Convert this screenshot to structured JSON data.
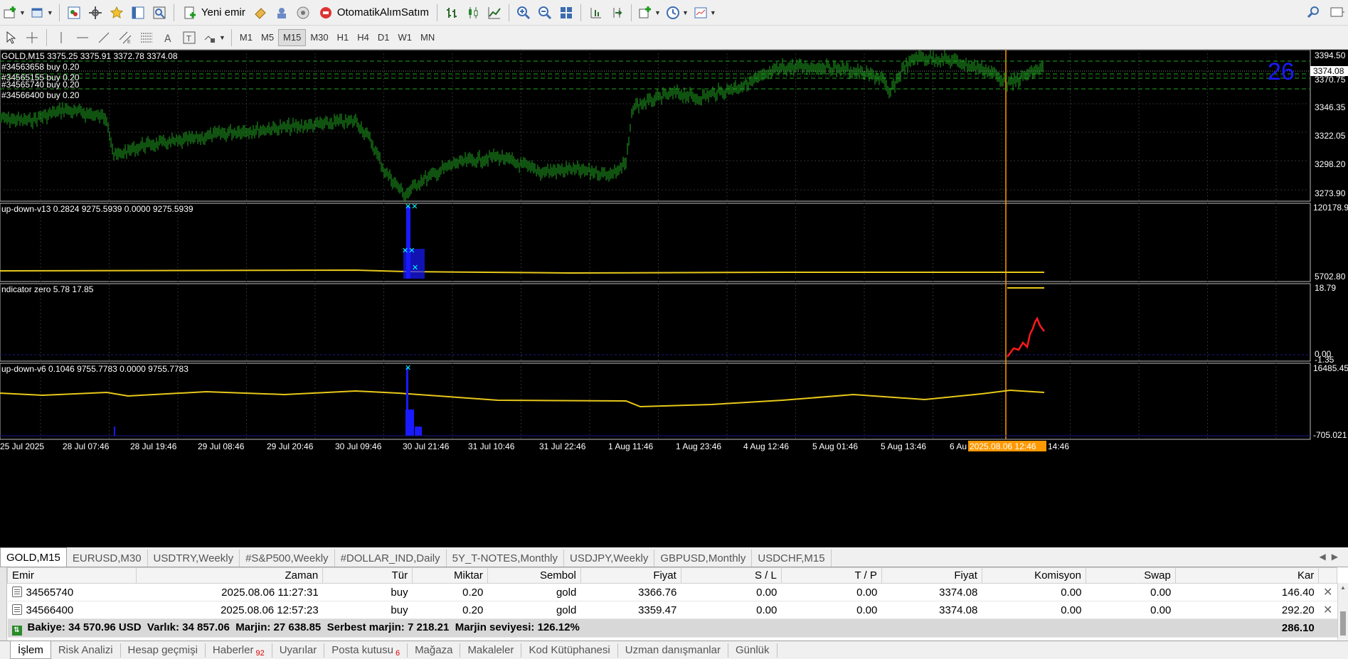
{
  "toolbar1": {
    "new_order_label": "Yeni emir",
    "autotrade_label": "OtomatikAlımSatım"
  },
  "toolbar2": {
    "timeframes": [
      "M1",
      "M5",
      "M15",
      "M30",
      "H1",
      "H4",
      "D1",
      "W1",
      "MN"
    ],
    "active_timeframe": "M15"
  },
  "chart": {
    "main_info": "GOLD,M15  3375.25 3375.91 3372.78 3374.08",
    "orders": [
      "#34563658 buy 0.20",
      "#34565155 buy 0.20",
      "#34565740 buy 0.20",
      "#34566400 buy 0.20"
    ],
    "counter": "26",
    "current_price": "3374.08",
    "price_ticks": [
      "3394.50",
      "3370.75",
      "3346.35",
      "3322.05",
      "3298.20",
      "3273.90"
    ],
    "panel1_label": "up-down-v13 0.2824 9275.5939 0.0000 9275.5939",
    "panel1_ticks": [
      "120178.9",
      "5702.80"
    ],
    "panel2_label": "ndicator zero 5.78 17.85",
    "panel2_ticks": [
      "18.79",
      "0.00",
      "-1.35"
    ],
    "panel3_label": "up-down-v6 0.1046 9755.7783 0.0000 9755.7783",
    "panel3_ticks": [
      "16485.45",
      "-705.021"
    ],
    "time_labels": [
      "25 Jul 2025",
      "28 Jul 07:46",
      "28 Jul 19:46",
      "29 Jul 08:46",
      "29 Jul 20:46",
      "30 Jul 09:46",
      "30 Jul 21:46",
      "31 Jul 10:46",
      "31 Jul 22:46",
      "1 Aug 11:46",
      "1 Aug 23:46",
      "4 Aug 12:46",
      "5 Aug 01:46",
      "5 Aug 13:46",
      "6 Au"
    ],
    "crosshair_time": "2025.08.06 12:46",
    "tail_time": "14:46",
    "colors": {
      "candles": "#1fa51f",
      "grid": "#3a5a3a",
      "yellow": "#e8c81a",
      "blue": "#1a1aff",
      "red": "#ff1a1a",
      "cursor": "#ff9900",
      "counter": "#1a1aff"
    }
  },
  "chart_tabs": [
    "GOLD,M15",
    "EURUSD,M30",
    "USDTRY,Weekly",
    "#S&P500,Weekly",
    "#DOLLAR_IND,Daily",
    "5Y_T-NOTES,Monthly",
    "USDJPY,Weekly",
    "GBPUSD,Monthly",
    "USDCHF,M15"
  ],
  "table": {
    "headers": [
      "Emir",
      "Zaman",
      "Tür",
      "Miktar",
      "Sembol",
      "Fiyat",
      "S / L",
      "T / P",
      "Fiyat",
      "Komisyon",
      "Swap",
      "Kar"
    ],
    "rows": [
      {
        "order": "34565740",
        "time": "2025.08.06 11:27:31",
        "type": "buy",
        "size": "0.20",
        "symbol": "gold",
        "price": "3366.76",
        "sl": "0.00",
        "tp": "0.00",
        "cur": "3374.08",
        "commission": "0.00",
        "swap": "0.00",
        "profit": "146.40"
      },
      {
        "order": "34566400",
        "time": "2025.08.06 12:57:23",
        "type": "buy",
        "size": "0.20",
        "symbol": "gold",
        "price": "3359.47",
        "sl": "0.00",
        "tp": "0.00",
        "cur": "3374.08",
        "commission": "0.00",
        "swap": "0.00",
        "profit": "292.20"
      }
    ],
    "summary": "Bakiye: 34 570.96 USD  Varlık: 34 857.06  Marjin: 27 638.85  Serbest marjin: 7 218.21  Marjin seviyesi: 126.12%",
    "summary_profit": "286.10"
  },
  "terminal_tabs": [
    {
      "label": "İşlem",
      "badge": ""
    },
    {
      "label": "Risk Analizi",
      "badge": ""
    },
    {
      "label": "Hesap geçmişi",
      "badge": ""
    },
    {
      "label": "Haberler",
      "badge": "92"
    },
    {
      "label": "Uyarılar",
      "badge": ""
    },
    {
      "label": "Posta kutusu",
      "badge": "6"
    },
    {
      "label": "Mağaza",
      "badge": ""
    },
    {
      "label": "Makaleler",
      "badge": ""
    },
    {
      "label": "Kod Kütüphanesi",
      "badge": ""
    },
    {
      "label": "Uzman danışmanlar",
      "badge": ""
    },
    {
      "label": "Günlük",
      "badge": ""
    }
  ],
  "icons": [
    "new-chart-icon",
    "profiles-icon",
    "market-watch-icon",
    "navigator-icon",
    "favorites-icon",
    "data-window-icon",
    "strategy-tester-icon",
    "new-order-icon",
    "metaeditor-icon",
    "copy-trading-icon",
    "autotrading-icon",
    "bar-chart-icon",
    "candlestick-icon",
    "line-chart-icon",
    "zoom-in-icon",
    "zoom-out-icon",
    "tile-windows-icon",
    "auto-scroll-icon",
    "chart-shift-icon",
    "indicators-icon",
    "periods-icon",
    "templates-icon",
    "search-icon",
    "expand-icon"
  ]
}
